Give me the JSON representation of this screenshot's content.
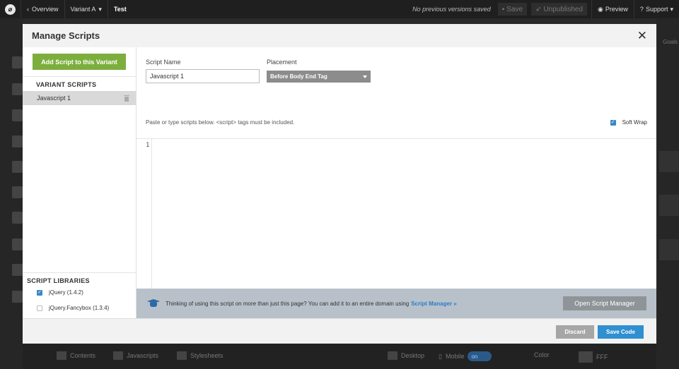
{
  "topbar": {
    "back_label": "Overview",
    "variant_label": "Variant A",
    "page_name": "Test",
    "versions_status": "No previous versions saved",
    "save_label": "Save",
    "publish_label": "Unpublished",
    "preview_label": "Preview",
    "support_label": "Support"
  },
  "background": {
    "right_label": "Goals",
    "bottom_tabs": [
      "Contents",
      "Javascripts",
      "Stylesheets"
    ],
    "desktop_label": "Desktop",
    "mobile_label": "Mobile",
    "mobile_toggle": "on",
    "color_label": "Color",
    "color_value": "FFF"
  },
  "modal": {
    "title": "Manage Scripts",
    "add_script_label": "Add Script to this Variant",
    "variant_scripts_title": "VARIANT SCRIPTS",
    "scripts": [
      {
        "name": "Javascript 1",
        "selected": true
      }
    ],
    "script_libraries_title": "SCRIPT LIBRARIES",
    "libraries": [
      {
        "name": "jQuery (1.4.2)",
        "checked": true
      },
      {
        "name": "jQuery.Fancybox (1.3.4)",
        "checked": false
      }
    ],
    "script_name_label": "Script Name",
    "script_name_value": "Javascript 1",
    "placement_label": "Placement",
    "placement_value": "Before Body End Tag",
    "hint": "Paste or type scripts below. <script> tags must be included.",
    "soft_wrap_label": "Soft Wrap",
    "soft_wrap_checked": true,
    "line_number": "1",
    "code": "",
    "notice_text": "Thinking of using this script on more than just this page? You can add it to an entire domain using",
    "notice_link": "Script Manager »",
    "open_manager_label": "Open Script Manager",
    "discard_label": "Discard",
    "save_code_label": "Save Code"
  },
  "colors": {
    "accent_green": "#7cae3d",
    "primary_blue": "#2f8fd0",
    "link_blue": "#2a7cc8",
    "notice_bg": "#b8c1ca"
  },
  "icons": [
    "logo-icon",
    "chevron-left-icon",
    "caret-down-icon",
    "save-icon",
    "publish-icon",
    "eye-icon",
    "help-icon",
    "close-icon",
    "trash-icon",
    "graduation-cap-icon"
  ]
}
